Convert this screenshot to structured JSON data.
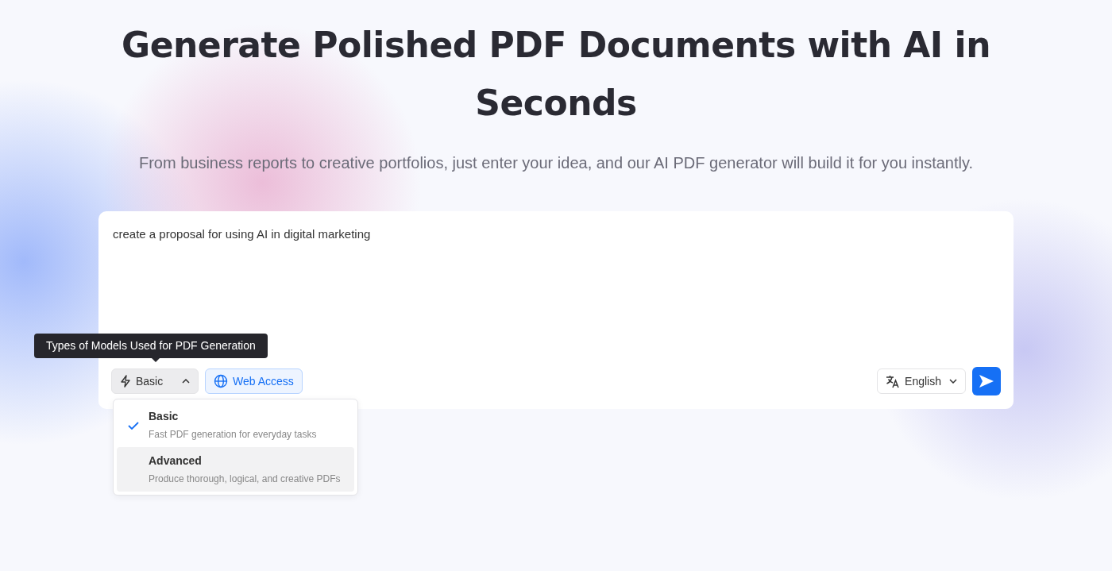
{
  "headline": "Generate Polished PDF Documents with AI in Seconds",
  "subtitle": "From business reports to creative portfolios, just enter your idea, and our AI PDF generator will build it for you instantly.",
  "prompt": {
    "value": "create a proposal for using AI in digital marketing"
  },
  "tooltip": "Types of Models Used for PDF Generation",
  "model_button": {
    "label": "Basic",
    "expanded": true
  },
  "web_access": {
    "label": "Web Access",
    "on": true
  },
  "model_menu": [
    {
      "title": "Basic",
      "description": "Fast PDF generation for everyday tasks",
      "selected": true,
      "highlighted": false
    },
    {
      "title": "Advanced",
      "description": "Produce thorough, logical, and creative PDFs",
      "selected": false,
      "highlighted": true
    }
  ],
  "language": {
    "label": "English"
  }
}
